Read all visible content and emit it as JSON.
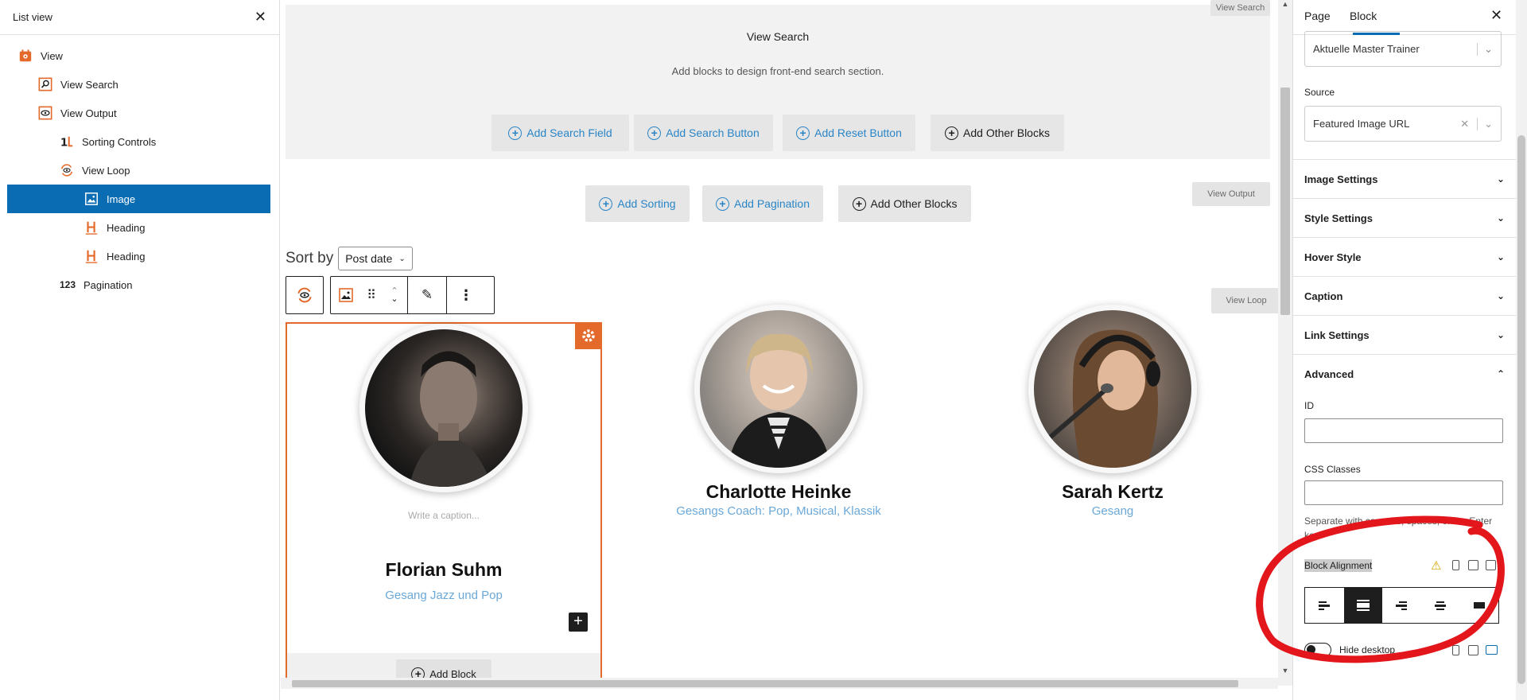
{
  "list_view": {
    "title": "List view",
    "items": [
      {
        "label": "View",
        "icon": "view-icon"
      },
      {
        "label": "View Search",
        "icon": "search-icon"
      },
      {
        "label": "View Output",
        "icon": "eye-icon"
      },
      {
        "label": "Sorting Controls",
        "icon": "sort-icon"
      },
      {
        "label": "View Loop",
        "icon": "loop-icon"
      },
      {
        "label": "Image",
        "icon": "image-icon"
      },
      {
        "label": "Heading",
        "icon": "heading-icon"
      },
      {
        "label": "Heading",
        "icon": "heading-icon"
      },
      {
        "label": "Pagination",
        "icon": "pagination-icon",
        "glyph": "123"
      }
    ]
  },
  "canvas": {
    "search_section": {
      "tag": "View Search",
      "title": "View Search",
      "subtitle": "Add blocks to design front-end search section.",
      "buttons": [
        "Add Search Field",
        "Add Search Button",
        "Add Reset Button",
        "Add Other Blocks"
      ]
    },
    "output_section": {
      "tag": "View Output",
      "buttons": [
        "Add Sorting",
        "Add Pagination",
        "Add Other Blocks"
      ]
    },
    "loop_tag": "View Loop",
    "sort": {
      "label": "Sort by",
      "value": "Post date"
    },
    "people": [
      {
        "name": "Florian Suhm",
        "role": "Gesang Jazz und Pop",
        "caption": "Write a caption..."
      },
      {
        "name": "Charlotte Heinke",
        "role": "Gesangs Coach: Pop, Musical, Klassik"
      },
      {
        "name": "Sarah Kertz",
        "role": "Gesang"
      }
    ],
    "add_block": "Add Block"
  },
  "sidebar": {
    "tabs": [
      "Page",
      "Block"
    ],
    "active_tab": "Block",
    "top_select": "Aktuelle Master Trainer",
    "source_label": "Source",
    "source_value": "Featured Image URL",
    "panels": [
      "Image Settings",
      "Style Settings",
      "Hover Style",
      "Caption",
      "Link Settings",
      "Advanced"
    ],
    "id_label": "ID",
    "css_label": "CSS Classes",
    "css_help": "Separate with commas, spaces, or the Enter key.",
    "align_label": "Block Alignment",
    "hide_label": "Hide desktop"
  },
  "colors": {
    "accent": "#e36a2b",
    "selected": "#0a6cb3",
    "link": "#2a85c7",
    "annotation": "#e3161b"
  }
}
